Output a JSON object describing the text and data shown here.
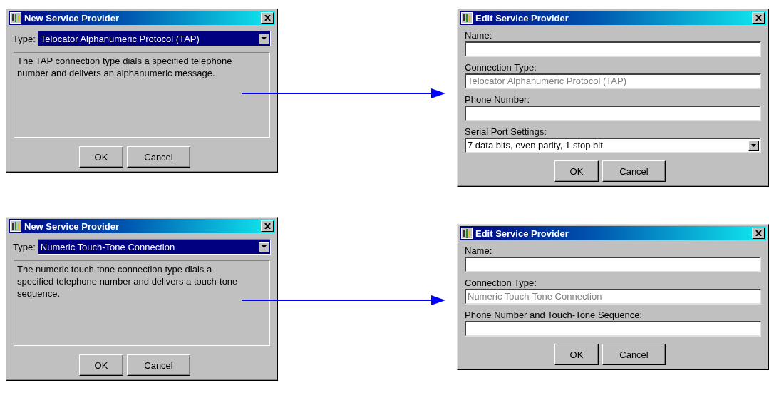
{
  "rows": [
    {
      "new_dialog": {
        "title": "New Service Provider",
        "type_label": "Type:",
        "type_value": "Telocator Alphanumeric Protocol (TAP)",
        "description": "The TAP connection type dials a specified telephone number and delivers an alphanumeric message.",
        "buttons": [
          "OK",
          "Cancel"
        ]
      },
      "edit_dialog": {
        "title": "Edit Service Provider",
        "fields": [
          {
            "label": "Name:",
            "kind": "text"
          },
          {
            "label": "Connection Type:",
            "kind": "text",
            "value": "Telocator Alphanumeric Protocol (TAP)",
            "disabled": true
          },
          {
            "label": "Phone Number:",
            "kind": "text"
          },
          {
            "label": "Serial Port Settings:",
            "kind": "dropdown",
            "value": "7 data bits, even parity, 1 stop bit",
            "disabled": false
          }
        ],
        "buttons": [
          "OK",
          "Cancel"
        ]
      }
    },
    {
      "new_dialog": {
        "title": "New Service Provider",
        "type_label": "Type:",
        "type_value": "Numeric Touch-Tone Connection",
        "description": "The numeric touch-tone connection type dials a specified telephone number and delivers a touch-tone sequence.",
        "buttons": [
          "OK",
          "Cancel"
        ]
      },
      "edit_dialog": {
        "title": "Edit Service Provider",
        "fields": [
          {
            "label": "Name:",
            "kind": "text"
          },
          {
            "label": "Connection Type:",
            "kind": "text",
            "value": "Numeric Touch-Tone Connection",
            "disabled": true
          },
          {
            "label": "Phone Number and Touch-Tone Sequence:",
            "kind": "text"
          }
        ],
        "buttons": [
          "OK",
          "Cancel"
        ]
      }
    }
  ]
}
